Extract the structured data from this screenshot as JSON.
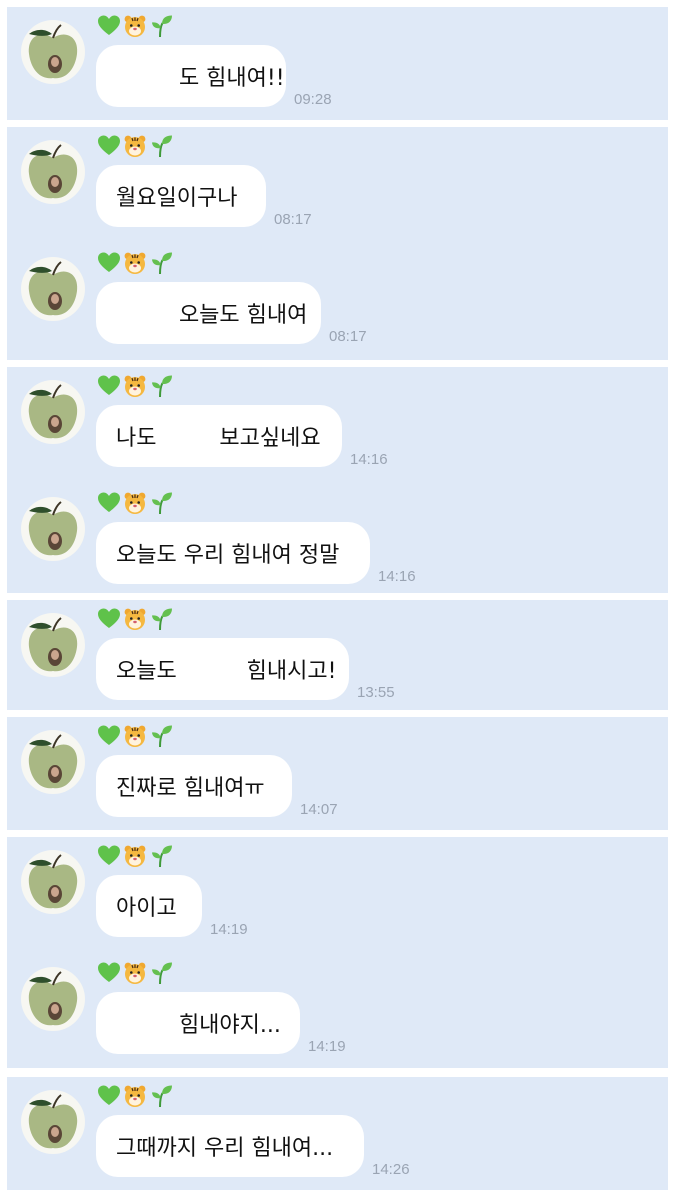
{
  "colors": {
    "page_background": "#ffffff",
    "panel_background": "#dfe9f7",
    "bubble_background": "#ffffff",
    "timestamp_text": "#9aa4b3",
    "message_text": "#111111"
  },
  "sender": {
    "avatar_icon": "green-apple-icon",
    "name_icons": [
      "green-heart-icon",
      "tiger-face-icon",
      "seedling-icon"
    ]
  },
  "panels": [
    {
      "messages": [
        {
          "text": "         도 힘내여!!",
          "time": "09:28"
        }
      ]
    },
    {
      "messages": [
        {
          "text": "월요일이구나",
          "time": "08:17"
        },
        {
          "text": "         오늘도 힘내여",
          "time": "08:17"
        }
      ]
    },
    {
      "messages": [
        {
          "text": "나도         보고싶네요",
          "time": "14:16"
        },
        {
          "text": "오늘도 우리 힘내여 정말",
          "time": "14:16"
        }
      ]
    },
    {
      "messages": [
        {
          "text": "오늘도          힘내시고!",
          "time": "13:55"
        }
      ]
    },
    {
      "messages": [
        {
          "text": "진짜로 힘내여ㅠ",
          "time": "14:07"
        }
      ]
    },
    {
      "messages": [
        {
          "text": "아이고",
          "time": "14:19"
        },
        {
          "text": "         힘내야지...",
          "time": "14:19"
        }
      ]
    },
    {
      "messages": [
        {
          "text": "그때까지 우리 힘내여...",
          "time": "14:26"
        }
      ]
    }
  ]
}
